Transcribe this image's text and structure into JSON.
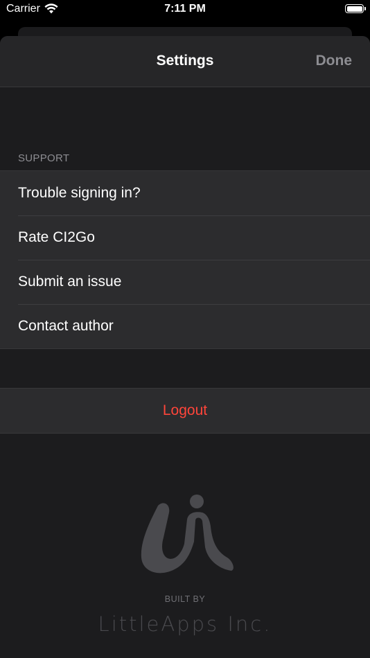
{
  "status_bar": {
    "carrier": "Carrier",
    "time": "7:11 PM"
  },
  "navbar": {
    "title": "Settings",
    "done_label": "Done"
  },
  "support": {
    "header": "SUPPORT",
    "items": [
      {
        "label": "Trouble signing in?"
      },
      {
        "label": "Rate CI2Go"
      },
      {
        "label": "Submit an issue"
      },
      {
        "label": "Contact author"
      }
    ]
  },
  "logout": {
    "label": "Logout",
    "color": "#ff453a"
  },
  "footer": {
    "built_by": "BUILT BY",
    "company": "LittleApps Inc."
  },
  "icons": [
    "wifi-icon",
    "battery-icon",
    "littleapps-logo"
  ]
}
